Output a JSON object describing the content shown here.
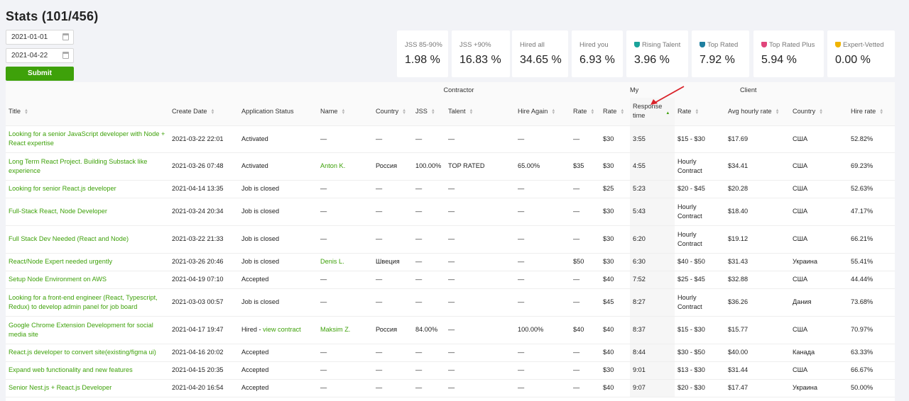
{
  "page": {
    "title": "Stats (101/456)"
  },
  "filters": {
    "date_from": "2021-01-01",
    "date_to": "2021-04-22",
    "submit_label": "Submit"
  },
  "stats": [
    {
      "label": "JSS 85-90%",
      "value": "1.98 %",
      "badge": ""
    },
    {
      "label": "JSS +90%",
      "value": "16.83 %",
      "badge": ""
    },
    {
      "label": "Hired all",
      "value": "34.65 %",
      "badge": ""
    },
    {
      "label": "Hired you",
      "value": "6.93 %",
      "badge": ""
    },
    {
      "label": "Rising Talent",
      "value": "3.96 %",
      "badge": "rising-talent-badge-icon",
      "color": "#1aa39a"
    },
    {
      "label": "Top Rated",
      "value": "7.92 %",
      "badge": "top-rated-badge-icon",
      "color": "#1f7fa0"
    },
    {
      "label": "Top Rated Plus",
      "value": "5.94 %",
      "badge": "top-rated-plus-badge-icon",
      "color": "#e0457b"
    },
    {
      "label": "Expert-Vetted",
      "value": "0.00 %",
      "badge": "expert-vetted-badge-icon",
      "color": "#f0b400"
    }
  ],
  "table": {
    "groups": {
      "contractor": "Contractor",
      "my": "My",
      "client": "Client"
    },
    "headers": {
      "title": "Title",
      "create_date": "Create Date",
      "application_status": "Application Status",
      "name": "Name",
      "country": "Country",
      "jss": "JSS",
      "talent": "Talent",
      "hire_again": "Hire Again",
      "contractor_rate": "Rate",
      "my_rate": "Rate",
      "response_time_1": "Response",
      "response_time_2": "time",
      "client_rate": "Rate",
      "avg_hourly_rate": "Avg hourly rate",
      "client_country": "Country",
      "hire_rate": "Hire rate"
    },
    "rows": [
      {
        "title": "Looking for a senior JavaScript developer with Node + React expertise",
        "date": "2021-03-22 22:01",
        "status": "Activated",
        "status_link": "",
        "name": "—",
        "country": "—",
        "jss": "—",
        "talent": "—",
        "hire_again": "—",
        "c_rate": "—",
        "my_rate": "$30",
        "resp": "3:55",
        "cl_rate": "$15 - $30",
        "avg": "$17.69",
        "cl_country": "США",
        "hire_rate": "52.82%"
      },
      {
        "title": "Long Term React Project. Building Substack like experience",
        "date": "2021-03-26 07:48",
        "status": "Activated",
        "status_link": "",
        "name": "Anton K.",
        "country": "Россия",
        "jss": "100.00%",
        "talent": "TOP RATED",
        "hire_again": "65.00%",
        "c_rate": "$35",
        "my_rate": "$30",
        "resp": "4:55",
        "cl_rate": "Hourly Contract",
        "avg": "$34.41",
        "cl_country": "США",
        "hire_rate": "69.23%"
      },
      {
        "title": "Looking for senior React.js developer",
        "date": "2021-04-14 13:35",
        "status": "Job is closed",
        "status_link": "",
        "name": "—",
        "country": "—",
        "jss": "—",
        "talent": "—",
        "hire_again": "—",
        "c_rate": "—",
        "my_rate": "$25",
        "resp": "5:23",
        "cl_rate": "$20 - $45",
        "avg": "$20.28",
        "cl_country": "США",
        "hire_rate": "52.63%"
      },
      {
        "title": "Full-Stack React, Node Developer",
        "date": "2021-03-24 20:34",
        "status": "Job is closed",
        "status_link": "",
        "name": "—",
        "country": "—",
        "jss": "—",
        "talent": "—",
        "hire_again": "—",
        "c_rate": "—",
        "my_rate": "$30",
        "resp": "5:43",
        "cl_rate": "Hourly Contract",
        "avg": "$18.40",
        "cl_country": "США",
        "hire_rate": "47.17%"
      },
      {
        "title": "Full Stack Dev Needed (React and Node)",
        "date": "2021-03-22 21:33",
        "status": "Job is closed",
        "status_link": "",
        "name": "—",
        "country": "—",
        "jss": "—",
        "talent": "—",
        "hire_again": "—",
        "c_rate": "—",
        "my_rate": "$30",
        "resp": "6:20",
        "cl_rate": "Hourly Contract",
        "avg": "$19.12",
        "cl_country": "США",
        "hire_rate": "66.21%"
      },
      {
        "title": "React/Node Expert needed urgently",
        "date": "2021-03-26 20:46",
        "status": "Job is closed",
        "status_link": "",
        "name": "Denis L.",
        "country": "Швеция",
        "jss": "—",
        "talent": "—",
        "hire_again": "—",
        "c_rate": "$50",
        "my_rate": "$30",
        "resp": "6:30",
        "cl_rate": "$40 - $50",
        "avg": "$31.43",
        "cl_country": "Украина",
        "hire_rate": "55.41%"
      },
      {
        "title": "Setup Node Environment on AWS",
        "date": "2021-04-19 07:10",
        "status": "Accepted",
        "status_link": "",
        "name": "—",
        "country": "—",
        "jss": "—",
        "talent": "—",
        "hire_again": "—",
        "c_rate": "—",
        "my_rate": "$40",
        "resp": "7:52",
        "cl_rate": "$25 - $45",
        "avg": "$32.88",
        "cl_country": "США",
        "hire_rate": "44.44%"
      },
      {
        "title": "Looking for a front-end engineer (React, Typescript, Redux) to develop admin panel for job board",
        "date": "2021-03-03 00:57",
        "status": "Job is closed",
        "status_link": "",
        "name": "—",
        "country": "—",
        "jss": "—",
        "talent": "—",
        "hire_again": "—",
        "c_rate": "—",
        "my_rate": "$45",
        "resp": "8:27",
        "cl_rate": "Hourly Contract",
        "avg": "$36.26",
        "cl_country": "Дания",
        "hire_rate": "73.68%"
      },
      {
        "title": "Google Chrome Extension Development for social media site",
        "date": "2021-04-17 19:47",
        "status": "Hired - ",
        "status_link": "view contract",
        "name": "Maksim Z.",
        "country": "Россия",
        "jss": "84.00%",
        "talent": "—",
        "hire_again": "100.00%",
        "c_rate": "$40",
        "my_rate": "$40",
        "resp": "8:37",
        "cl_rate": "$15 - $30",
        "avg": "$15.77",
        "cl_country": "США",
        "hire_rate": "70.97%"
      },
      {
        "title": "React.js developer to convert site(existing/figma ui)",
        "date": "2021-04-16 20:02",
        "status": "Accepted",
        "status_link": "",
        "name": "—",
        "country": "—",
        "jss": "—",
        "talent": "—",
        "hire_again": "—",
        "c_rate": "—",
        "my_rate": "$40",
        "resp": "8:44",
        "cl_rate": "$30 - $50",
        "avg": "$40.00",
        "cl_country": "Канада",
        "hire_rate": "63.33%"
      },
      {
        "title": "Expand web functionality and new features",
        "date": "2021-04-15 20:35",
        "status": "Accepted",
        "status_link": "",
        "name": "—",
        "country": "—",
        "jss": "—",
        "talent": "—",
        "hire_again": "—",
        "c_rate": "—",
        "my_rate": "$30",
        "resp": "9:01",
        "cl_rate": "$13 - $30",
        "avg": "$31.44",
        "cl_country": "США",
        "hire_rate": "66.67%"
      },
      {
        "title": "Senior Nest.js + React.js Developer",
        "date": "2021-04-20 16:54",
        "status": "Accepted",
        "status_link": "",
        "name": "—",
        "country": "—",
        "jss": "—",
        "talent": "—",
        "hire_again": "—",
        "c_rate": "—",
        "my_rate": "$40",
        "resp": "9:07",
        "cl_rate": "$20 - $30",
        "avg": "$17.47",
        "cl_country": "Украина",
        "hire_rate": "50.00%"
      }
    ]
  },
  "colors": {
    "accent": "#3ea10a",
    "annotation_arrow": "#d9232a"
  }
}
